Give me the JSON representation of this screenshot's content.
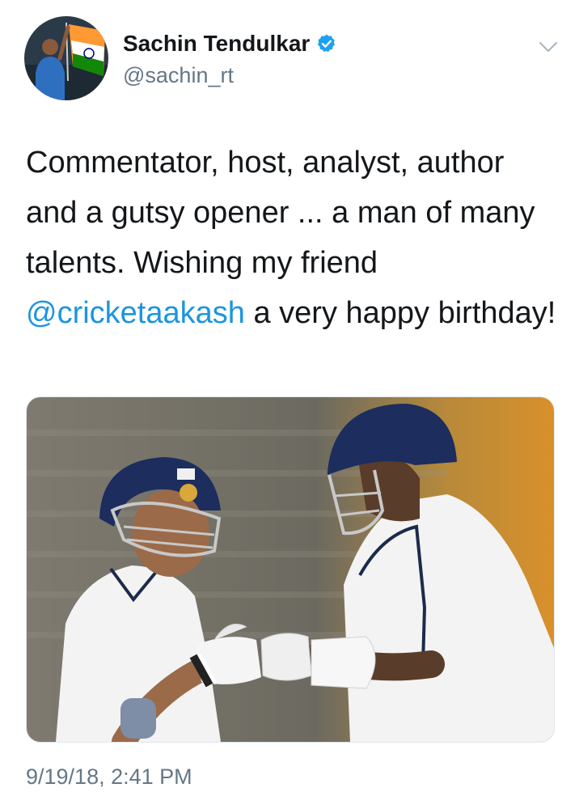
{
  "tweet": {
    "author": {
      "display_name": "Sachin Tendulkar",
      "handle": "@sachin_rt",
      "verified": true
    },
    "text_before_mention": "Commentator, host, analyst, author and a gutsy opener ... a man of many talents. Wishing my friend ",
    "mention": "@cricketaakash",
    "text_after_mention": " a very happy birthday!",
    "timestamp": "9/19/18, 2:41 PM"
  },
  "icons": {
    "verified": "verified-badge-icon",
    "menu": "chevron-down-icon"
  },
  "colors": {
    "link": "#1b95e0",
    "secondary_text": "#657786",
    "verified_badge": "#1da1f2"
  }
}
